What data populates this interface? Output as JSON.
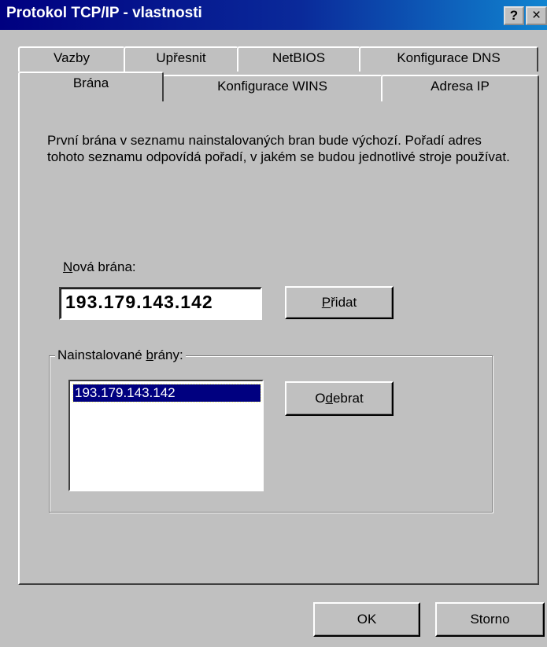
{
  "window": {
    "title": "Protokol TCP/IP - vlastnosti",
    "help_label": "?",
    "close_label": "×"
  },
  "tabs": {
    "back_row": [
      {
        "label": "Vazby"
      },
      {
        "label": "Upřesnit"
      },
      {
        "label": "NetBIOS"
      },
      {
        "label": "Konfigurace DNS"
      }
    ],
    "front_row": [
      {
        "label": "Brána",
        "selected": true
      },
      {
        "label": "Konfigurace WINS"
      },
      {
        "label": "Adresa IP"
      }
    ]
  },
  "panel": {
    "description": "První brána v seznamu nainstalovaných bran bude výchozí. Pořadí adres tohoto seznamu odpovídá pořadí, v jakém se budou jednotlivé stroje používat.",
    "new_gateway": {
      "label_accel": "N",
      "label_rest": "ová brána:",
      "value": "193.179.143.142"
    },
    "add_button": {
      "accel": "P",
      "rest": "řidat"
    },
    "installed": {
      "label_pre": "Nainstalované ",
      "label_accel": "b",
      "label_rest": "rány:",
      "items": [
        "193.179.143.142"
      ],
      "selected_index": 0
    },
    "remove_button": {
      "pre": "O",
      "accel": "d",
      "rest": "ebrat"
    }
  },
  "footer": {
    "ok_label": "OK",
    "cancel_label": "Storno"
  },
  "colors": {
    "titlebar_start": "#000080",
    "titlebar_end": "#1084d0",
    "face": "#c0c0c0",
    "selection": "#000080"
  }
}
